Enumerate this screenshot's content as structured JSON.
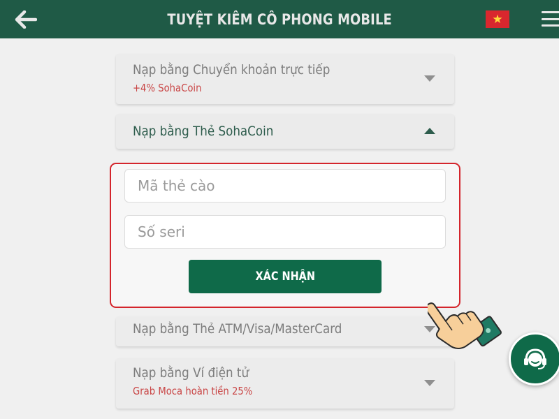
{
  "header": {
    "title": "TUYỆT KIÊM CÔ PHONG MOBILE",
    "back_icon": "arrow-left-icon",
    "language_flag": "vietnam-flag-icon",
    "menu_icon": "hamburger-menu-icon"
  },
  "payment_methods": [
    {
      "label": "Nạp bằng Chuyển khoản trực tiếp",
      "promo": "+4% SohaCoin",
      "expanded": false
    },
    {
      "label": "Nạp bằng Thẻ SohaCoin",
      "expanded": true
    },
    {
      "label": "Nạp bằng Thẻ ATM/Visa/MasterCard",
      "expanded": false
    },
    {
      "label": "Nạp bằng Ví điện tử",
      "promo": "Grab Moca hoàn tiền 25%",
      "expanded": false
    }
  ],
  "card_form": {
    "code_placeholder": "Mã thẻ cào",
    "serial_placeholder": "Số seri",
    "submit_label": "XÁC NHẬN"
  },
  "support": {
    "icon": "headset-support-icon"
  },
  "colors": {
    "header_bg": "#1f5a46",
    "primary_button": "#0f6a49",
    "highlight_border": "#d4252c",
    "promo_text": "#c94545",
    "active_title": "#2d5c4c"
  }
}
